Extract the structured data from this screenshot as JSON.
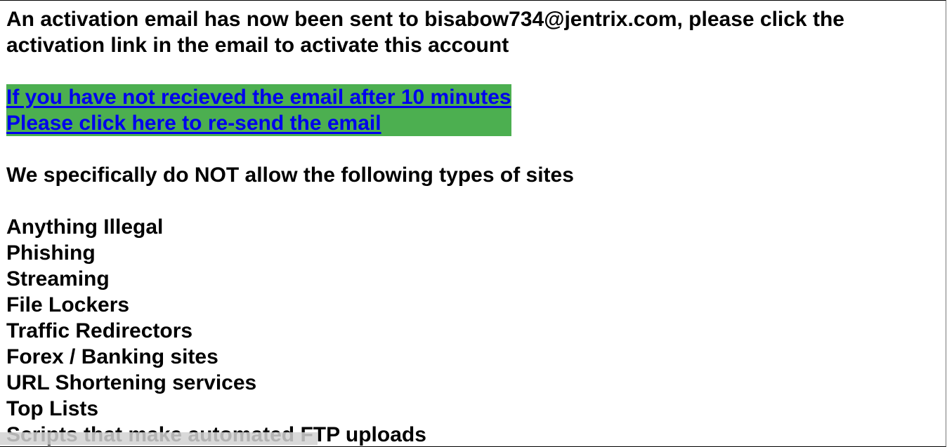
{
  "message": {
    "line1": "An activation email has now been sent to bisabow734@jentrix.com, please click the",
    "line2": "activation link in the email to activate this account"
  },
  "resend_link": {
    "line1": "If you have not recieved the email after 10 minutes",
    "line2": "Please click here to re-send the email",
    "background_color": "#4caf50",
    "link_color": "#0000ee"
  },
  "policy": {
    "heading": "We specifically do NOT allow the following types of sites",
    "items": [
      "Anything Illegal",
      "Phishing",
      "Streaming",
      "File Lockers",
      "Traffic Redirectors",
      "Forex / Banking sites",
      "URL Shortening services",
      "Top Lists",
      "Scripts that make automated FTP uploads"
    ]
  }
}
